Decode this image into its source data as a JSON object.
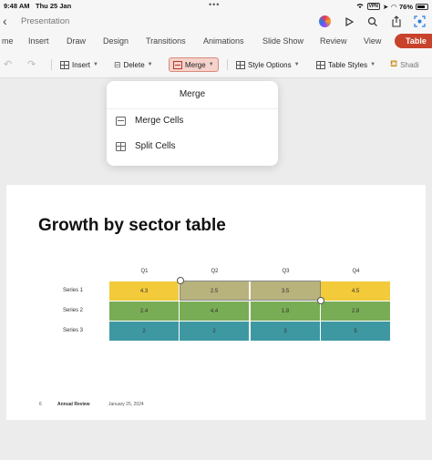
{
  "status": {
    "time": "9:48 AM",
    "date": "Thu 25 Jan",
    "vpn": "VPN",
    "battery": "76%"
  },
  "titlebar": {
    "title": "Presentation"
  },
  "tabs": [
    {
      "label": "Home",
      "text": "me"
    },
    {
      "label": "Insert",
      "text": "Insert"
    },
    {
      "label": "Draw",
      "text": "Draw"
    },
    {
      "label": "Design",
      "text": "Design"
    },
    {
      "label": "Transitions",
      "text": "Transitions"
    },
    {
      "label": "Animations",
      "text": "Animations"
    },
    {
      "label": "Slide Show",
      "text": "Slide Show"
    },
    {
      "label": "Review",
      "text": "Review"
    },
    {
      "label": "View",
      "text": "View"
    },
    {
      "label": "Table",
      "text": "Table"
    }
  ],
  "ribbon": {
    "insert": "Insert",
    "delete": "Delete",
    "merge": "Merge",
    "style_options": "Style Options",
    "table_styles": "Table Styles",
    "shading": "Shadi"
  },
  "merge_menu": {
    "title": "Merge",
    "items": [
      "Merge Cells",
      "Split Cells"
    ]
  },
  "slide": {
    "title": "Growth by sector table",
    "table": {
      "columns": [
        "Q1",
        "Q2",
        "Q3",
        "Q4"
      ],
      "rows": [
        {
          "name": "Series 1",
          "values": [
            "4.3",
            "2.5",
            "3.5",
            "4.5"
          ]
        },
        {
          "name": "Series 2",
          "values": [
            "2.4",
            "4.4",
            "1.8",
            "2.8"
          ]
        },
        {
          "name": "Series 3",
          "values": [
            "2",
            "2",
            "3",
            "5"
          ]
        }
      ]
    },
    "footer": {
      "number": "6",
      "org": "Annual Review",
      "date": "January 25, 2024"
    }
  },
  "colors": {
    "accent": "#c8432b",
    "series1": "#f2ca3a",
    "series1_selected": "#b8b27c",
    "series2": "#79ad55",
    "series3": "#3e98a2"
  }
}
